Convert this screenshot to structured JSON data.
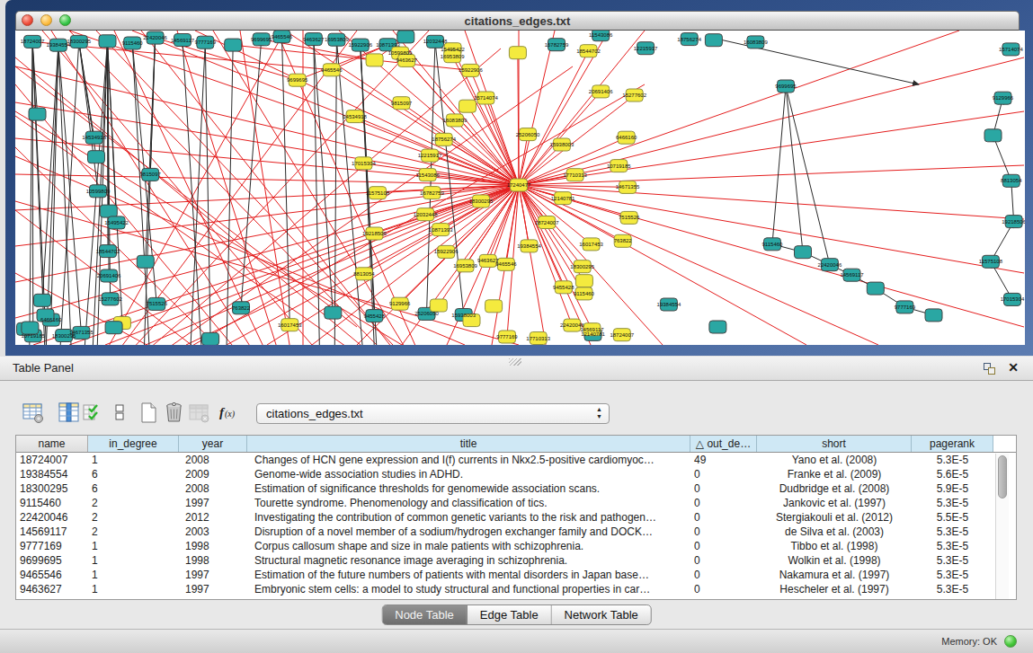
{
  "window": {
    "title": "citations_edges.txt",
    "controls": [
      "close",
      "minimize",
      "zoom"
    ]
  },
  "network": {
    "seed": 11,
    "colors": {
      "teal_node": "#2aa7a3",
      "teal_border": "#444444",
      "yellow_node": "#f4ea3e",
      "yellow_border": "#8f8f3f",
      "red_edge": "#e41e1e",
      "black_edge": "#2a2a2a",
      "label": "#111111"
    },
    "hub_label": "17240477",
    "node_labels": [
      "18724007",
      "19384554",
      "18300295",
      "9115460",
      "22420046",
      "14569117",
      "9777169",
      "9699695",
      "9465546",
      "9463627",
      "16953809",
      "15922906",
      "10871393",
      "12032448",
      "16782759",
      "11543086",
      "12215917",
      "18756274",
      "16083809",
      "15714074",
      "9129966",
      "8813054",
      "19218506",
      "11575108",
      "17015304",
      "14534918",
      "9815097",
      "10599809",
      "15495422",
      "18544702",
      "20691406",
      "15277602",
      "6466160",
      "10719185",
      "14671355",
      "7515526",
      "763822",
      "16017453",
      "9455428",
      "25206050",
      "15938003",
      "17710313",
      "12140781"
    ]
  },
  "table_panel": {
    "title": "Table Panel",
    "float_icon": "float-panel",
    "close_icon": "close-panel",
    "toolbar": {
      "icons": [
        {
          "name": "table-column-settings"
        },
        {
          "name": "show-column"
        },
        {
          "name": "select-all"
        },
        {
          "name": "column-chooser"
        },
        {
          "name": "new-table"
        },
        {
          "name": "delete-table"
        },
        {
          "name": "delete-table-disabled"
        },
        {
          "name": "function-builder",
          "label": "f(x)"
        }
      ],
      "table_selector": {
        "value": "citations_edges.txt"
      }
    },
    "table": {
      "columns": [
        {
          "label": "name"
        },
        {
          "label": "in_degree"
        },
        {
          "label": "year"
        },
        {
          "label": "title"
        },
        {
          "label": "out_de…",
          "sort_icon": "△"
        },
        {
          "label": "short"
        },
        {
          "label": "pagerank"
        }
      ],
      "rows": [
        [
          "18724007",
          "1",
          "2008",
          "Changes of HCN gene expression and I(f) currents in Nkx2.5-positive cardiomyoc…",
          "49",
          "Yano et al. (2008)",
          "5.3E-5"
        ],
        [
          "19384554",
          "6",
          "2009",
          "Genome-wide association studies in ADHD.",
          "0",
          "Franke et al. (2009)",
          "5.6E-5"
        ],
        [
          "18300295",
          "6",
          "2008",
          "Estimation of significance thresholds for genomewide association scans.",
          "0",
          "Dudbridge et al. (2008)",
          "5.9E-5"
        ],
        [
          "9115460",
          "2",
          "1997",
          "Tourette syndrome. Phenomenology and classification of tics.",
          "0",
          "Jankovic et al. (1997)",
          "5.3E-5"
        ],
        [
          "22420046",
          "2",
          "2012",
          "Investigating the contribution of common genetic variants to the risk and pathogen…",
          "0",
          "Stergiakouli et al. (2012)",
          "5.5E-5"
        ],
        [
          "14569117",
          "2",
          "2003",
          "Disruption of a novel member of a sodium/hydrogen exchanger family and DOCK…",
          "0",
          "de Silva et al. (2003)",
          "5.3E-5"
        ],
        [
          "9777169",
          "1",
          "1998",
          "Corpus callosum shape and size in male patients with schizophrenia.",
          "0",
          "Tibbo et al. (1998)",
          "5.3E-5"
        ],
        [
          "9699695",
          "1",
          "1998",
          "Structural magnetic resonance image averaging in schizophrenia.",
          "0",
          "Wolkin et al. (1998)",
          "5.3E-5"
        ],
        [
          "9465546",
          "1",
          "1997",
          "Estimation of the future numbers of patients with mental disorders in Japan base…",
          "0",
          "Nakamura et al. (1997)",
          "5.3E-5"
        ],
        [
          "9463627",
          "1",
          "1997",
          "Embryonic stem cells: a model to study structural and functional properties in car…",
          "0",
          "Hescheler et al. (1997)",
          "5.3E-5"
        ]
      ]
    },
    "tabs": [
      {
        "label": "Node Table",
        "selected": true
      },
      {
        "label": "Edge Table",
        "selected": false
      },
      {
        "label": "Network Table",
        "selected": false
      }
    ]
  },
  "status_bar": {
    "memory_label": "Memory: OK",
    "memory_status_color": "#3fbf3f"
  }
}
